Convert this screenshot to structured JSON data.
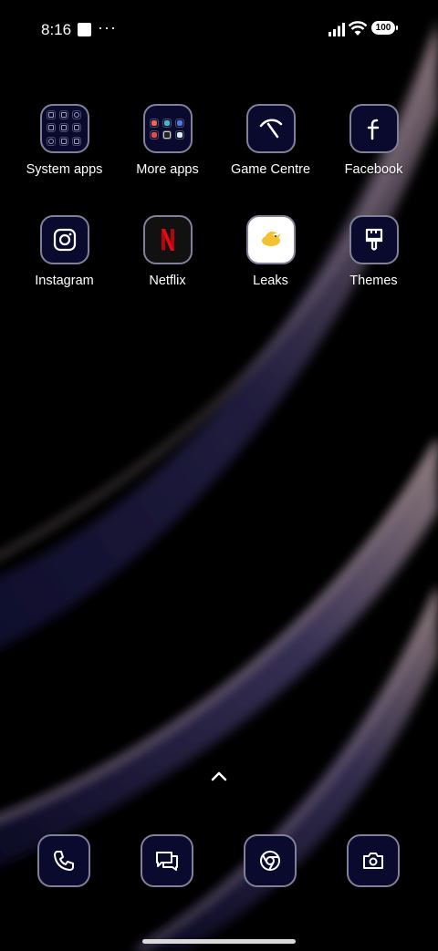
{
  "status": {
    "time": "8:16",
    "more": "···",
    "battery": "100"
  },
  "apps": [
    {
      "label": "System apps",
      "icon": "folder-icon"
    },
    {
      "label": "More apps",
      "icon": "folder-icon"
    },
    {
      "label": "Game Centre",
      "icon": "game-centre-icon"
    },
    {
      "label": "Facebook",
      "icon": "facebook-icon"
    },
    {
      "label": "Instagram",
      "icon": "instagram-icon"
    },
    {
      "label": "Netflix",
      "icon": "netflix-icon"
    },
    {
      "label": "Leaks",
      "icon": "leaks-bird-icon"
    },
    {
      "label": "Themes",
      "icon": "paintbrush-icon"
    }
  ],
  "dock": [
    {
      "icon": "phone-icon"
    },
    {
      "icon": "messages-icon"
    },
    {
      "icon": "chrome-icon"
    },
    {
      "icon": "camera-icon"
    }
  ],
  "colors": {
    "icon_bg": "#0a0a2e",
    "icon_border": "#7e8197",
    "netflix_red": "#e50914",
    "leaks_yellow": "#f2c230"
  }
}
